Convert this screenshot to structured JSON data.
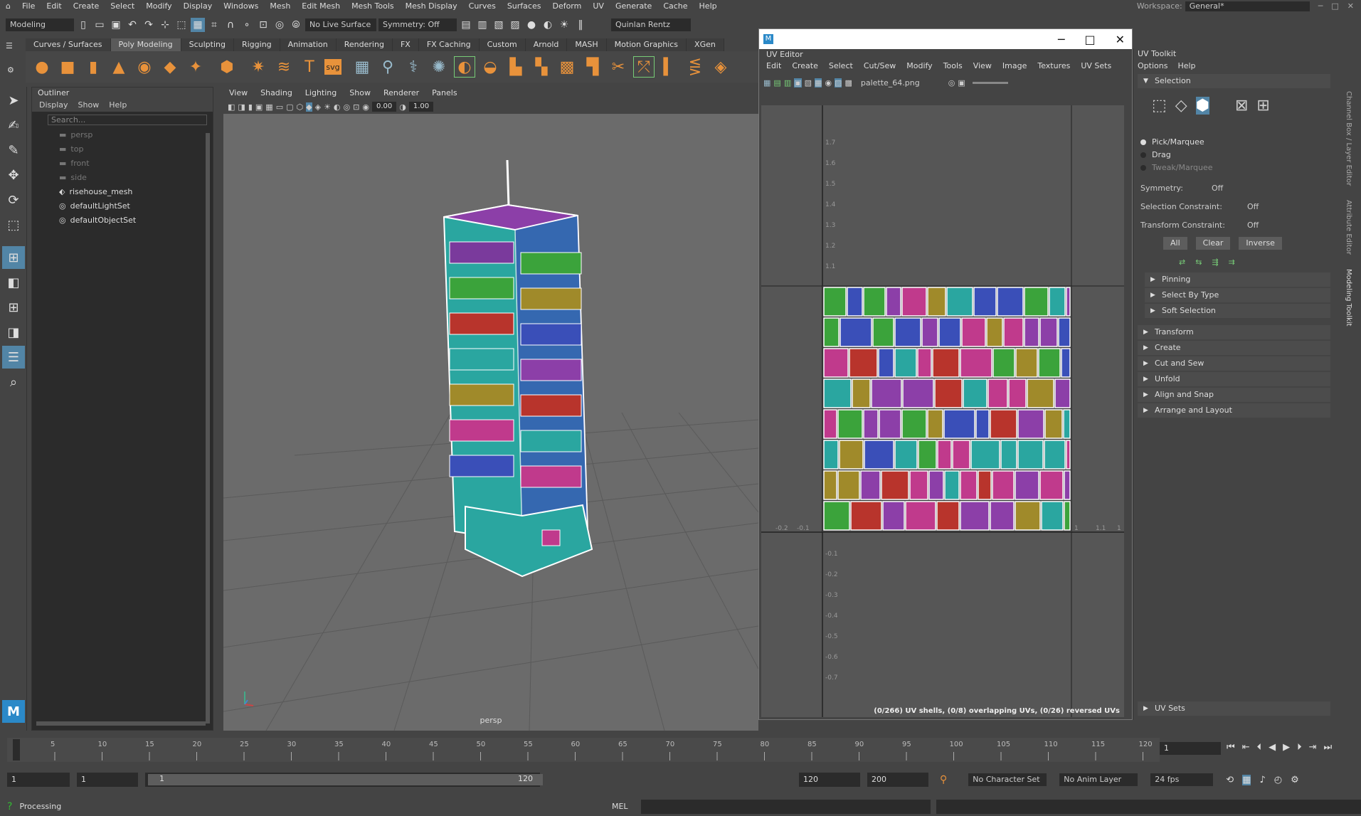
{
  "menubar": {
    "items": [
      "File",
      "Edit",
      "Create",
      "Select",
      "Modify",
      "Display",
      "Windows",
      "Mesh",
      "Edit Mesh",
      "Mesh Tools",
      "Mesh Display",
      "Curves",
      "Surfaces",
      "Deform",
      "UV",
      "Generate",
      "Cache",
      "Help"
    ],
    "workspace_label": "Workspace:",
    "workspace_value": "General*"
  },
  "statusline": {
    "mode": "Modeling",
    "live_surface": "No Live Surface",
    "symmetry": "Symmetry: Off",
    "user": "Quinlan Rentz"
  },
  "shelf": {
    "tabs": [
      "Curves / Surfaces",
      "Poly Modeling",
      "Sculpting",
      "Rigging",
      "Animation",
      "Rendering",
      "FX",
      "FX Caching",
      "Custom",
      "Arnold",
      "MASH",
      "Motion Graphics",
      "XGen"
    ],
    "active_tab": "Poly Modeling"
  },
  "outliner": {
    "title": "Outliner",
    "menu": [
      "Display",
      "Show",
      "Help"
    ],
    "search_placeholder": "Search...",
    "items": [
      {
        "label": "persp",
        "dim": true
      },
      {
        "label": "top",
        "dim": true
      },
      {
        "label": "front",
        "dim": true
      },
      {
        "label": "side",
        "dim": true
      },
      {
        "label": "risehouse_mesh",
        "dim": false
      },
      {
        "label": "defaultLightSet",
        "dim": false
      },
      {
        "label": "defaultObjectSet",
        "dim": false
      }
    ]
  },
  "viewport": {
    "menu": [
      "View",
      "Shading",
      "Lighting",
      "Show",
      "Renderer",
      "Panels"
    ],
    "value_a": "0.00",
    "value_b": "1.00",
    "camera_label": "persp"
  },
  "uv_editor": {
    "title": "UV Editor",
    "menu": [
      "Edit",
      "Create",
      "Select",
      "Cut/Sew",
      "Modify",
      "Tools",
      "View",
      "Image",
      "Textures",
      "UV Sets"
    ],
    "texture": "palette_64.png",
    "v_ticks": [
      "1.7",
      "1.6",
      "1.5",
      "1.4",
      "1.3",
      "1.2",
      "1.1",
      "-0.1",
      "-0.2",
      "-0.3",
      "-0.4",
      "-0.5",
      "-0.6",
      "-0.7"
    ],
    "u_ticks": [
      "-0.2",
      "-0.1",
      "1",
      "1.1",
      "1"
    ],
    "status": "(0/266) UV shells, (0/8) overlapping UVs, (0/26) reversed UVs"
  },
  "uv_toolkit": {
    "title": "UV Toolkit",
    "menu": [
      "Options",
      "Help"
    ],
    "selection_section": "Selection",
    "modes": [
      "Pick/Marquee",
      "Drag",
      "Tweak/Marquee"
    ],
    "symmetry_label": "Symmetry:",
    "symmetry_value": "Off",
    "sel_constraint_label": "Selection Constraint:",
    "sel_constraint_value": "Off",
    "xform_constraint_label": "Transform Constraint:",
    "xform_constraint_value": "Off",
    "buttons": [
      "All",
      "Clear",
      "Inverse"
    ],
    "subsections": [
      "Pinning",
      "Select By Type",
      "Soft Selection"
    ],
    "sections": [
      "Transform",
      "Create",
      "Cut and Sew",
      "Unfold",
      "Align and Snap",
      "Arrange and Layout"
    ],
    "uv_sets": "UV Sets"
  },
  "side_tabs": [
    "Channel Box / Layer Editor",
    "Attribute Editor",
    "Modeling Toolkit"
  ],
  "timeline": {
    "ticks": [
      "5",
      "10",
      "15",
      "20",
      "25",
      "30",
      "35",
      "40",
      "45",
      "50",
      "55",
      "60",
      "65",
      "70",
      "75",
      "80",
      "85",
      "90",
      "95",
      "100",
      "105",
      "110",
      "115",
      "120"
    ],
    "current_frame": "1"
  },
  "range": {
    "start": "1",
    "start2": "1",
    "slider_start": "1",
    "slider_end": "120",
    "end": "120",
    "end2": "200",
    "character_set": "No Character Set",
    "anim_layer": "No Anim Layer",
    "fps": "24 fps"
  },
  "cmdline": {
    "status": "Processing",
    "lang": "MEL"
  },
  "colors": {
    "accent": "#5285a6",
    "shelf_icon": "#e8923b",
    "uv_border": "#ffffff"
  }
}
